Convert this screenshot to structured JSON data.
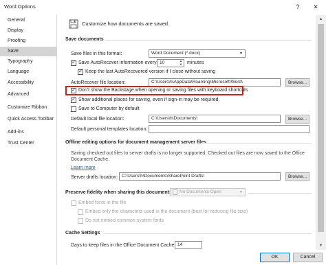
{
  "window": {
    "title": "Word Options",
    "help_glyph": "?",
    "close_glyph": "✕"
  },
  "sidebar": {
    "items": [
      {
        "label": "General"
      },
      {
        "label": "Display"
      },
      {
        "label": "Proofing"
      },
      {
        "label": "Save"
      },
      {
        "label": "Typography"
      },
      {
        "label": "Language"
      },
      {
        "label": "Accessibility"
      },
      {
        "label": "Advanced"
      },
      {
        "label": "Customize Ribbon"
      },
      {
        "label": "Quick Access Toolbar"
      },
      {
        "label": "Add-ins"
      },
      {
        "label": "Trust Center"
      }
    ],
    "selected": "Save"
  },
  "header": {
    "text": "Customize how documents are saved."
  },
  "save_documents": {
    "heading": "Save documents",
    "format_label": "Save files in this format:",
    "format_value": "Word Document (*.docx)",
    "autorecover_label": "Save AutoRecover information every",
    "autorecover_minutes": "10",
    "minutes_label": "minutes",
    "keep_last_label": "Keep the last AutoRecovered version if I close without saving",
    "autorecover_location_label": "AutoRecover file location:",
    "autorecover_location_value": "C:\\Users\\h\\AppData\\Roaming\\Microsoft\\Word\\",
    "browse_label": "Browse...",
    "backstage_label": "Don't show the Backstage when opening or saving files with keyboard shortcuts",
    "additional_places_label": "Show additional places for saving, even if sign-in may be required.",
    "save_to_computer_label": "Save to Computer by default",
    "default_local_label": "Default local file location:",
    "default_local_value": "C:\\Users\\h\\Documents\\",
    "default_templates_label": "Default personal templates location:",
    "default_templates_value": ""
  },
  "offline": {
    "heading": "Offline editing options for document management server files",
    "description": "Saving checked out files to server drafts is no longer supported. Checked out files are now saved to the Office Document Cache.",
    "learn_more": "Learn more",
    "server_drafts_label": "Server drafts location:",
    "server_drafts_value": "C:\\Users\\h\\Documents\\SharePoint Drafts\\",
    "browse_label": "Browse..."
  },
  "fidelity": {
    "heading": "Preserve fidelity when sharing this document:",
    "doc_select": "No Documents Open",
    "embed_fonts_label": "Embed fonts in the file",
    "embed_only_label": "Embed only the characters used in the document (best for reducing file size)",
    "no_common_label": "Do not embed common system fonts"
  },
  "cache": {
    "heading": "Cache Settings",
    "days_label": "Days to keep files in the Office Document Cache:",
    "days_value": "14"
  },
  "footer": {
    "ok_label": "OK",
    "cancel_label": "Cancel"
  }
}
